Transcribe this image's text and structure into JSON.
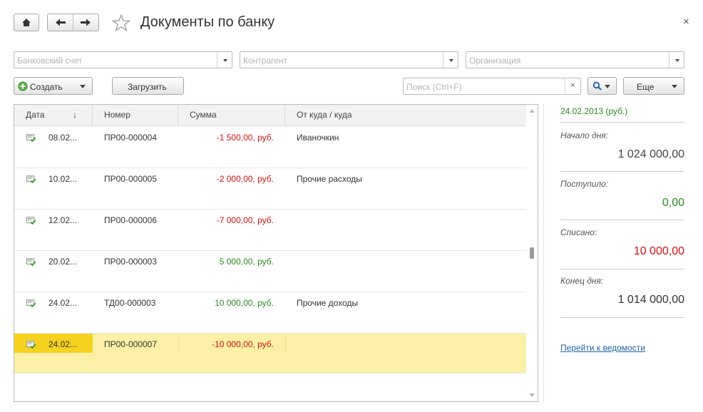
{
  "window": {
    "title": "Документы по банку",
    "close_glyph": "×"
  },
  "filters": {
    "bank_account_placeholder": "Банковский счет",
    "counterparty_placeholder": "Контрагент",
    "organization_placeholder": "Организация"
  },
  "toolbar": {
    "create_label": "Создать",
    "load_label": "Загрузить",
    "search_placeholder": "Поиск (Ctrl+F)",
    "search_clear": "×",
    "more_label": "Еще"
  },
  "table": {
    "columns": [
      "Дата",
      "Номер",
      "Сумма",
      "От куда / куда"
    ],
    "sort_indicator": "↓",
    "rows": [
      {
        "date": "08.02...",
        "number": "ПР00-000004",
        "amount": "-1 500,00, руб.",
        "sign": "neg",
        "counterpart": "Иваночкин"
      },
      {
        "date": "10.02...",
        "number": "ПР00-000005",
        "amount": "-2 000,00, руб.",
        "sign": "neg",
        "counterpart": "Прочие расходы"
      },
      {
        "date": "12.02...",
        "number": "ПР00-000006",
        "amount": "-7 000,00, руб.",
        "sign": "neg",
        "counterpart": ""
      },
      {
        "date": "20.02...",
        "number": "ПР00-000003",
        "amount": "5 000,00, руб.",
        "sign": "pos",
        "counterpart": ""
      },
      {
        "date": "24.02...",
        "number": "ТД00-000003",
        "amount": "10 000,00, руб.",
        "sign": "pos",
        "counterpart": "Прочие доходы"
      },
      {
        "date": "24.02...",
        "number": "ПР00-000007",
        "amount": "-10 000,00, руб.",
        "sign": "neg",
        "counterpart": "",
        "selected": true
      }
    ]
  },
  "summary": {
    "date": "24.02.2013 (руб.)",
    "start_label": "Начало дня:",
    "start_value": "1 024 000,00",
    "in_label": "Поступило:",
    "in_value": "0,00",
    "out_label": "Списано:",
    "out_value": "10 000,00",
    "end_label": "Конец дня:",
    "end_value": "1 014 000,00",
    "link_label": "Перейти к ведомости"
  },
  "colors": {
    "negative": "#d01010",
    "positive": "#2a8a1f",
    "selected_row": "#fbf0a6",
    "selected_cell": "#f5d21f",
    "link": "#1f5fa8"
  }
}
